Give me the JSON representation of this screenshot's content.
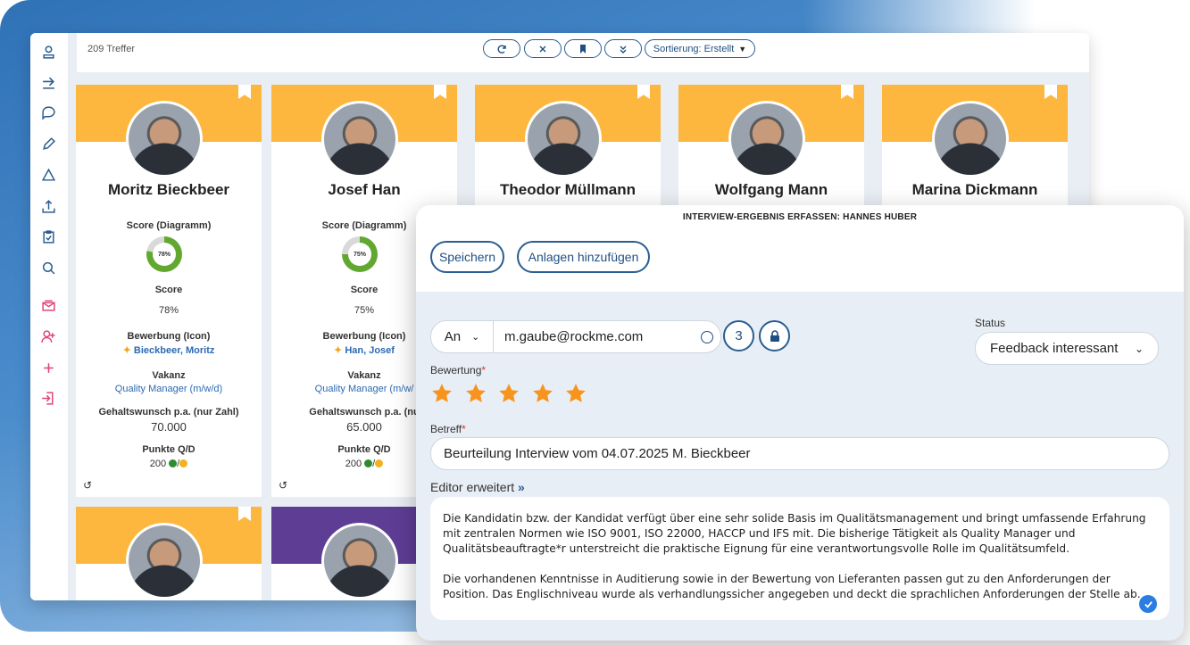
{
  "toolbar": {
    "hits": "209 Treffer",
    "sort_label": "Sortierung: Erstellt"
  },
  "cards": [
    {
      "name": "Moritz Bieckbeer",
      "score_chart_label": "Score (Diagramm)",
      "donut": "78%",
      "score_label": "Score",
      "score": "78%",
      "application_label": "Bewerbung (Icon)",
      "application": "Bieckbeer, Moritz",
      "vacancy_label": "Vakanz",
      "vacancy": "Quality Manager (m/w/d)",
      "salary_label": "Gehaltswunsch p.a. (nur Zahl)",
      "salary": "70.000",
      "points_label": "Punkte Q/D",
      "points": "200",
      "score_fraction": 0.78
    },
    {
      "name": "Josef Han",
      "score_chart_label": "Score (Diagramm)",
      "donut": "75%",
      "score_label": "Score",
      "score": "75%",
      "application_label": "Bewerbung (Icon)",
      "application": "Han, Josef",
      "vacancy_label": "Vakanz",
      "vacancy": "Quality Manager (m/w/",
      "salary_label": "Gehaltswunsch p.a. (nu",
      "salary": "65.000",
      "points_label": "Punkte Q/D",
      "points": "200",
      "score_fraction": 0.75
    },
    {
      "name": "Theodor Müllmann"
    },
    {
      "name": "Wolfgang Mann"
    },
    {
      "name": "Marina Dickmann"
    }
  ],
  "modal": {
    "title": "INTERVIEW-ERGEBNIS ERFASSEN: HANNES HUBER",
    "save_label": "Speichern",
    "attach_label": "Anlagen hinzufügen",
    "to_select": "An",
    "email": "m.gaube@rockme.com",
    "recipient_count": "3",
    "status_label": "Status",
    "status_value": "Feedback interessant",
    "rating_label": "Bewertung",
    "rating": 5,
    "subject_label": "Betreff",
    "subject": "Beurteilung Interview vom 04.07.2025 M. Bieckbeer",
    "editor_toggle": "Editor erweitert",
    "body_p1": "Die Kandidatin bzw. der Kandidat verfügt über eine sehr solide Basis im Qualitätsmanagement und bringt umfassende Erfahrung mit zentralen Normen wie ISO 9001, ISO 22000, HACCP und IFS mit. Die bisherige Tätigkeit als Quality Manager und Qualitätsbeauftragte*r unterstreicht die praktische Eignung für eine verantwortungsvolle Rolle im Qualitätsumfeld.",
    "body_p2": "Die vorhandenen Kenntnisse in Auditierung sowie in der Bewertung von Lieferanten passen gut zu den Anforderungen der Position. Das Englischniveau wurde als verhandlungssicher angegeben und deckt die sprachlichen Anforderungen der Stelle ab."
  },
  "colors": {
    "accent": "#2a5d91",
    "card_header": "#fdb73e",
    "card_header_alt": "#5e3d95",
    "star": "#f7941d",
    "donut": "#62a830"
  }
}
